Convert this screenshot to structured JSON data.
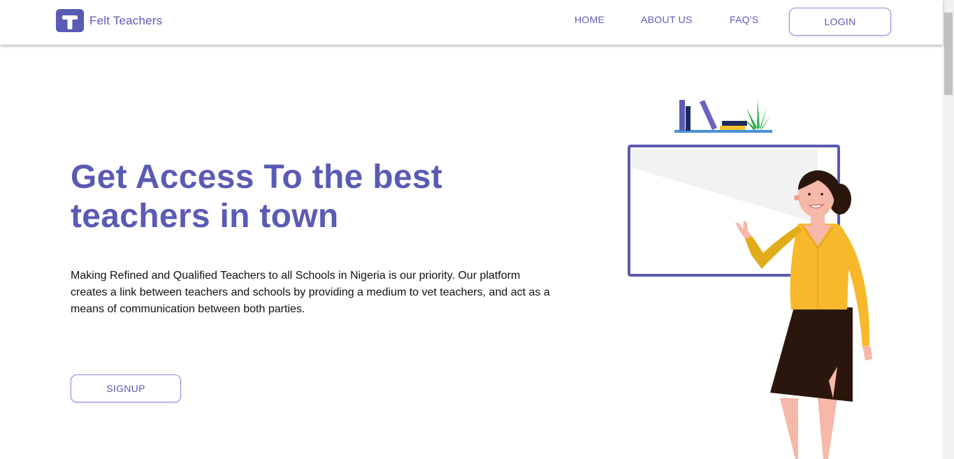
{
  "header": {
    "brand": "Felt Teachers",
    "logo_letter": "T",
    "nav": {
      "home": "HOME",
      "about": "ABOUT US",
      "faq": "FAQ'S"
    },
    "login_label": "LOGIN"
  },
  "hero": {
    "title_line1": "Get Access To the best",
    "title_line2": "teachers in town",
    "description": "Making Refined and Qualified Teachers to all Schools in Nigeria is our priority. Our platform creates a link between teachers and schools by providing a medium to vet teachers, and act as a means of communication between both parties.",
    "signup_label": "SIGNUP"
  },
  "colors": {
    "brand": "#5a5bb4",
    "accent_yellow": "#f7b92b",
    "skirt": "#2a160c"
  },
  "icons": {
    "logo": "t-logo-icon",
    "illustration": "teacher-whiteboard-illustration"
  }
}
